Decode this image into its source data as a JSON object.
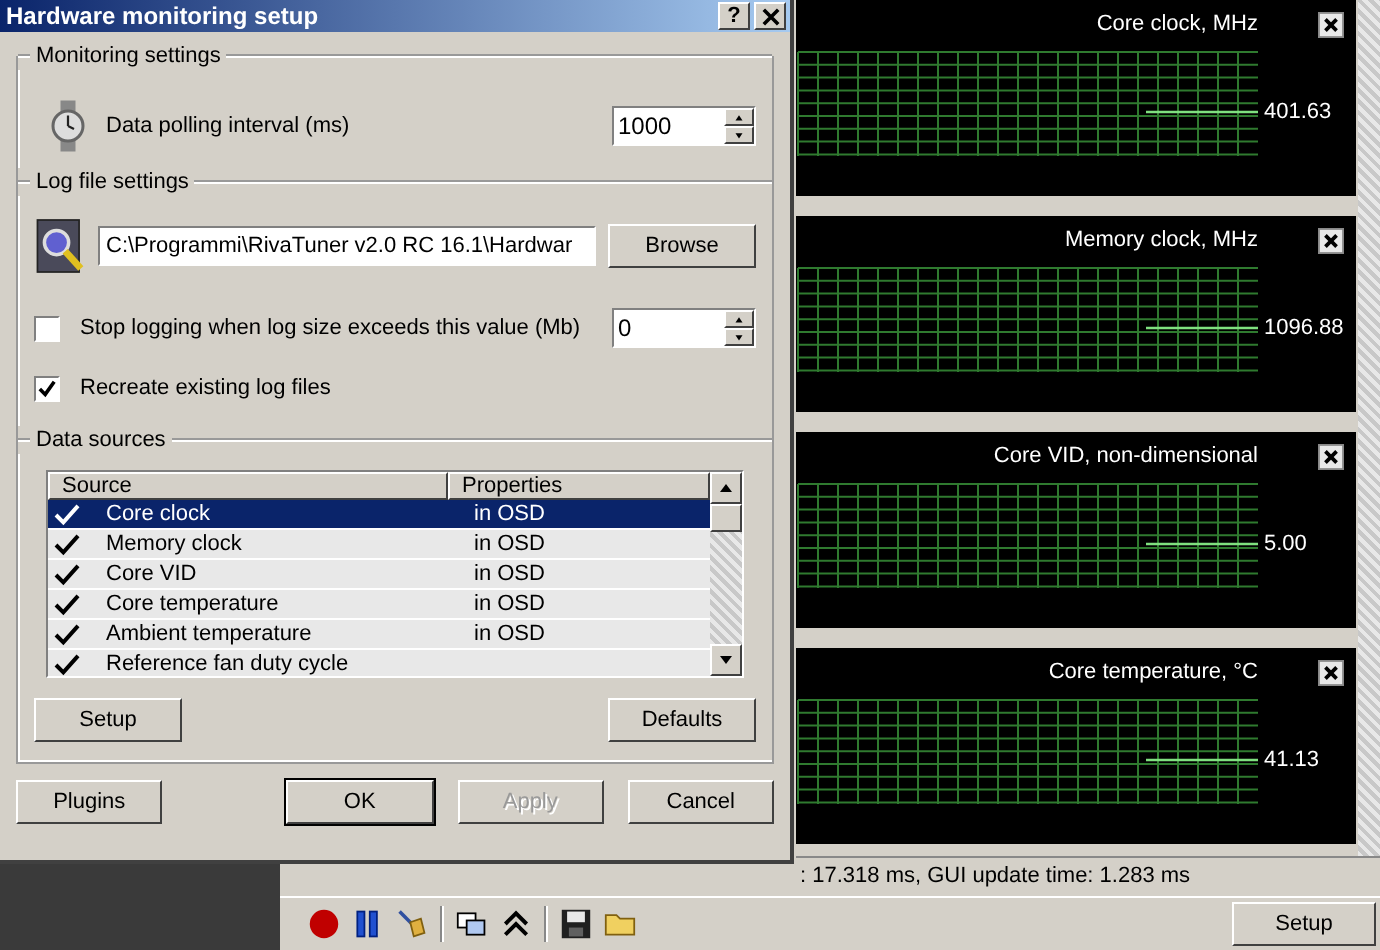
{
  "dialog": {
    "title": "Hardware monitoring setup",
    "help_button": "?",
    "monitoring": {
      "legend": "Monitoring settings",
      "polling_label": "Data polling interval (ms)",
      "polling_value": "1000"
    },
    "log": {
      "legend": "Log file settings",
      "path": "C:\\Programmi\\RivaTuner v2.0 RC 16.1\\Hardwar",
      "browse": "Browse",
      "stop_logging": {
        "label": "Stop logging when log size exceeds this value (Mb)",
        "checked": false,
        "value": "0"
      },
      "recreate": {
        "label": "Recreate existing log files",
        "checked": true
      }
    },
    "sources": {
      "legend": "Data sources",
      "columns": [
        "Source",
        "Properties"
      ],
      "rows": [
        {
          "source": "Core clock",
          "properties": "in OSD",
          "checked": true,
          "selected": true
        },
        {
          "source": "Memory clock",
          "properties": "in OSD",
          "checked": true,
          "selected": false
        },
        {
          "source": "Core VID",
          "properties": "in OSD",
          "checked": true,
          "selected": false
        },
        {
          "source": "Core temperature",
          "properties": "in OSD",
          "checked": true,
          "selected": false
        },
        {
          "source": "Ambient temperature",
          "properties": "in OSD",
          "checked": true,
          "selected": false
        },
        {
          "source": "Reference fan duty cycle",
          "checked": true,
          "selected": false
        }
      ],
      "setup": "Setup",
      "defaults": "Defaults"
    },
    "buttons": [
      {
        "label": "Plugins",
        "kind": "normal"
      },
      {
        "label": "OK",
        "kind": "default"
      },
      {
        "label": "Apply",
        "kind": "disabled"
      },
      {
        "label": "Cancel",
        "kind": "normal"
      }
    ]
  },
  "graphs": [
    {
      "title": "Core clock, MHz",
      "value": "401.63"
    },
    {
      "title": "Memory clock, MHz",
      "value": "1096.88"
    },
    {
      "title": "Core VID, non-dimensional",
      "value": "5.00"
    },
    {
      "title": "Core temperature, °C",
      "value": "41.13"
    }
  ],
  "status_bar": ": 17.318 ms, GUI update time: 1.283 ms",
  "toolbar": {
    "setup": "Setup"
  }
}
